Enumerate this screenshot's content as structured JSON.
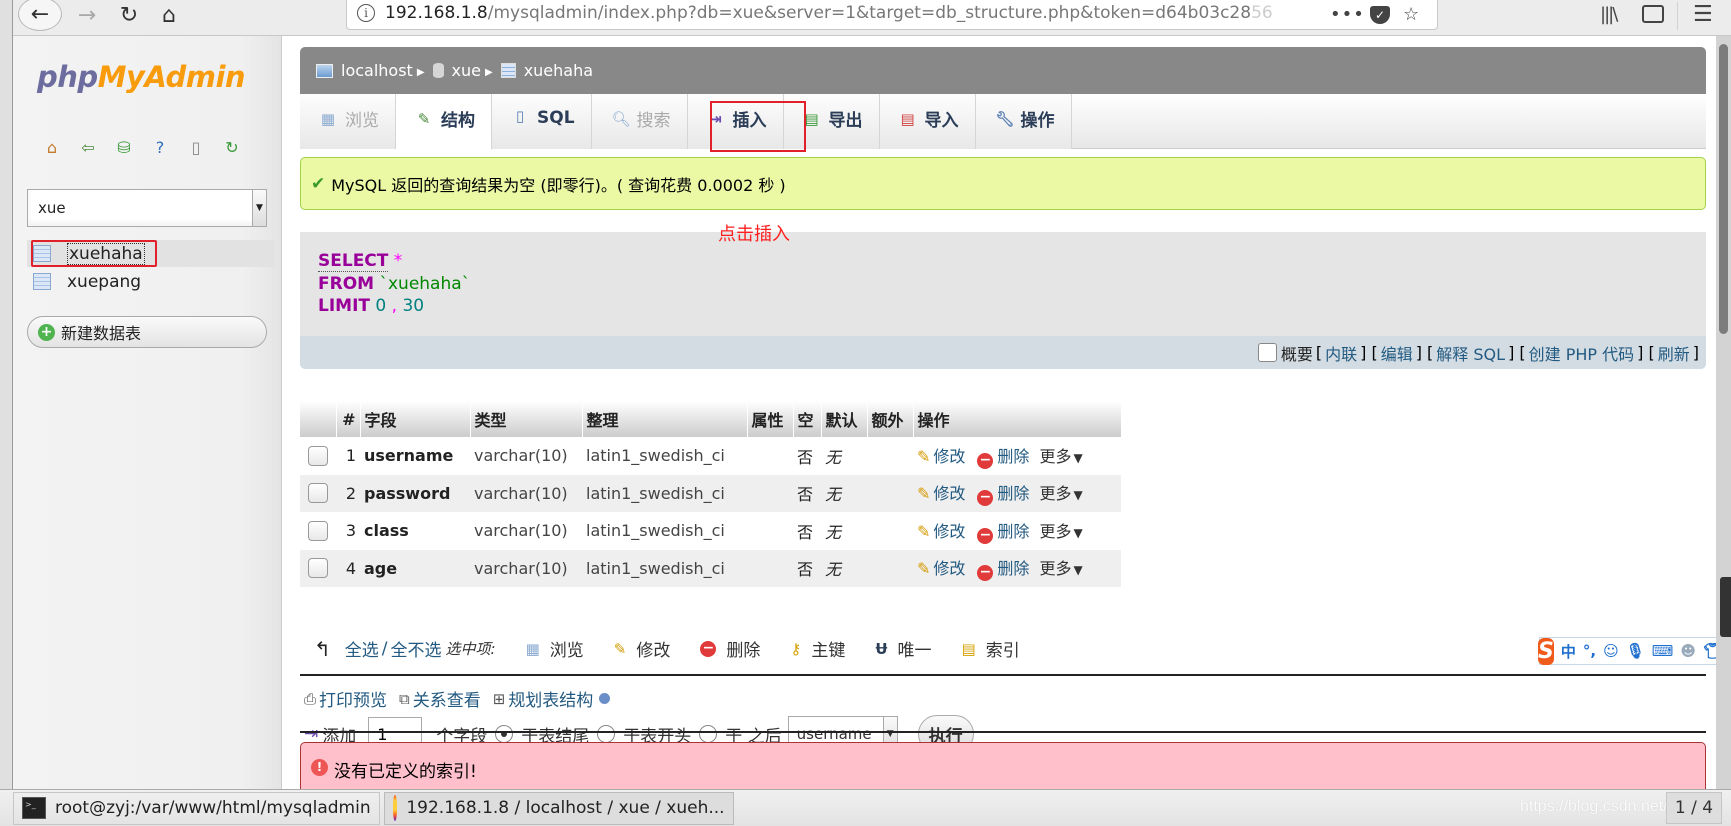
{
  "browser": {
    "url_host": "192.168.1.8",
    "url_path": "/mysqladmin/index.php?db=xue&server=1&target=db_structure.php&token=d64b03c28",
    "url_fade": "56",
    "more_label": "•••",
    "icons": [
      "back-icon",
      "forward-icon",
      "reload-icon",
      "home-icon",
      "info-icon",
      "pocket-icon",
      "star-icon",
      "library-icon",
      "sidebar-icon",
      "menu-icon"
    ]
  },
  "sidebar": {
    "logo_php": "php",
    "logo_mya": "MyAdmin",
    "db_selected": "xue",
    "tables": [
      {
        "name": "xuehaha"
      },
      {
        "name": "xuepang"
      }
    ],
    "new_table_label": "新建数据表"
  },
  "breadcrumb": {
    "server": "localhost",
    "database": "xue",
    "table": "xuehaha"
  },
  "tabs": [
    {
      "label": "浏览",
      "icon": "browse-icon",
      "state": "disabled"
    },
    {
      "label": "结构",
      "icon": "structure-icon",
      "state": "active"
    },
    {
      "label": "SQL",
      "icon": "sql-icon",
      "state": "normal"
    },
    {
      "label": "搜索",
      "icon": "search-icon",
      "state": "disabled"
    },
    {
      "label": "插入",
      "icon": "insert-icon",
      "state": "normal"
    },
    {
      "label": "导出",
      "icon": "export-icon",
      "state": "normal"
    },
    {
      "label": "导入",
      "icon": "import-icon",
      "state": "normal"
    },
    {
      "label": "操作",
      "icon": "operations-icon",
      "state": "normal"
    }
  ],
  "success_message": "MySQL 返回的查询结果为空 (即零行)。( 查询花费 0.0002 秒 )",
  "annotation": "点击插入",
  "sql": {
    "select": "SELECT",
    "star": "*",
    "from": "FROM",
    "table": "`xuehaha`",
    "limit": "LIMIT",
    "offset": "0",
    "comma": ",",
    "count": "30"
  },
  "sql_footer": {
    "profiling": "概要",
    "links": [
      "内联",
      "编辑",
      "解释 SQL",
      "创建 PHP 代码",
      "刷新"
    ]
  },
  "structure": {
    "headers": [
      "#",
      "字段",
      "类型",
      "整理",
      "属性",
      "空",
      "默认",
      "额外",
      "操作"
    ],
    "rows": [
      {
        "num": "1",
        "name": "username",
        "type": "varchar(10)",
        "collation": "latin1_swedish_ci",
        "attributes": "",
        "null": "否",
        "default": "无",
        "extra": ""
      },
      {
        "num": "2",
        "name": "password",
        "type": "varchar(10)",
        "collation": "latin1_swedish_ci",
        "attributes": "",
        "null": "否",
        "default": "无",
        "extra": ""
      },
      {
        "num": "3",
        "name": "class",
        "type": "varchar(10)",
        "collation": "latin1_swedish_ci",
        "attributes": "",
        "null": "否",
        "default": "无",
        "extra": ""
      },
      {
        "num": "4",
        "name": "age",
        "type": "varchar(10)",
        "collation": "latin1_swedish_ci",
        "attributes": "",
        "null": "否",
        "default": "无",
        "extra": ""
      }
    ],
    "row_actions": {
      "change": "修改",
      "drop": "删除",
      "more": "更多"
    }
  },
  "bulk": {
    "check_all": "全选",
    "separator": "/",
    "uncheck_all": "全不选",
    "with_selected": "选中项:",
    "actions": [
      "浏览",
      "修改",
      "删除",
      "主键",
      "唯一",
      "索引"
    ]
  },
  "links": {
    "print": "打印预览",
    "relation": "关系查看",
    "propose": "规划表结构"
  },
  "add_fields": {
    "label": "添加",
    "count": "1",
    "unit": "个字段",
    "opt_end": "于表结尾",
    "opt_begin": "于表开头",
    "opt_after": "于 之后",
    "after_field": "username",
    "go": "执行"
  },
  "error_message": "没有已定义的索引!",
  "ime": {
    "lang": "中",
    "punct": "°,"
  },
  "taskbar": {
    "terminal": "root@zyj:/var/www/html/mysqladmin",
    "browser": "192.168.1.8 / localhost / xue / xueh...",
    "watermark": "https://blog.csdn.net/X_pang",
    "pager": "1 / 4"
  }
}
